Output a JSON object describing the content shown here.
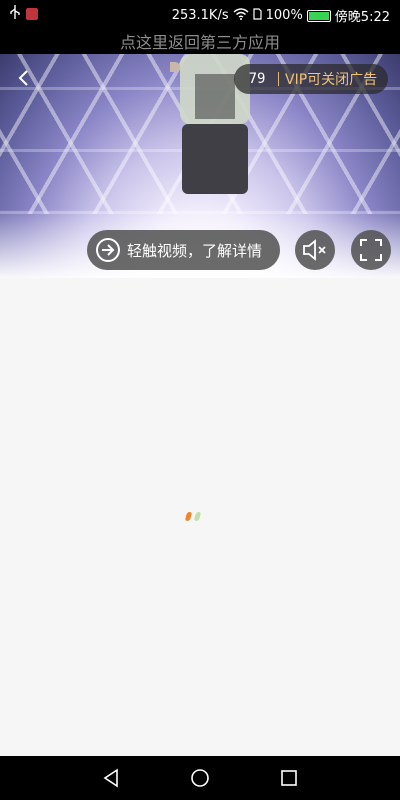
{
  "status_bar": {
    "speed": "253.1K/s",
    "battery_percent": "100%",
    "time": "傍晚5:22",
    "icons": [
      "usb-icon",
      "app-notification-icon",
      "wifi-icon",
      "sim-icon",
      "battery-icon"
    ]
  },
  "return_bar": {
    "label": "点这里返回第三方应用"
  },
  "video_ad": {
    "countdown": "79",
    "vip_close_label": "VIP可关闭广告",
    "learn_more_label": "轻触视频，了解详情",
    "icons": [
      "back-arrow-icon",
      "arrow-circle-icon",
      "mute-icon",
      "fullscreen-icon"
    ]
  },
  "loader": {
    "colors": [
      "#f0852d",
      "#bfe0a8"
    ]
  },
  "nav_bar": {
    "icons": [
      "back-triangle-icon",
      "home-circle-icon",
      "recents-square-icon"
    ]
  },
  "colors": {
    "vip_accent": "#f0c27a",
    "battery": "#39d353"
  }
}
